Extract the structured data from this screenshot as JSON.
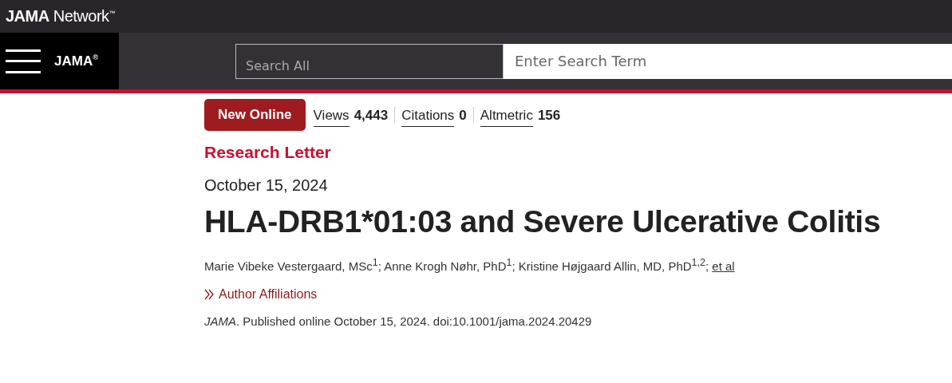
{
  "top_bar": {
    "brand": "JAMA",
    "brand_suffix": "Network",
    "trademark": "™"
  },
  "header": {
    "logo": "JAMA",
    "registered": "®",
    "search_scope": "Search All",
    "search": {
      "placeholder": "Enter Search Term"
    }
  },
  "badge": "New Online",
  "metrics": [
    {
      "label": "Views",
      "value": "4,443"
    },
    {
      "label": "Citations",
      "value": "0"
    },
    {
      "label": "Altmetric",
      "value": "156"
    }
  ],
  "article_type": "Research Letter",
  "date": "October 15, 2024",
  "title": "HLA-DRB1*01:03 and Severe Ulcerative Colitis",
  "authors": "Marie Vibeke Vestergaard, MSc$^{1}$; Anne Krogh Nøhr, PhD$^{1}$; Kristine Højgaard Allin, MD, PhD$^{1,2}$; ",
  "authors_link": "et al",
  "affiliations": "Author Affiliations",
  "citation": "*JAMA*. Published online October 15, 2024. doi:10.1001/jama.2024.20429"
}
